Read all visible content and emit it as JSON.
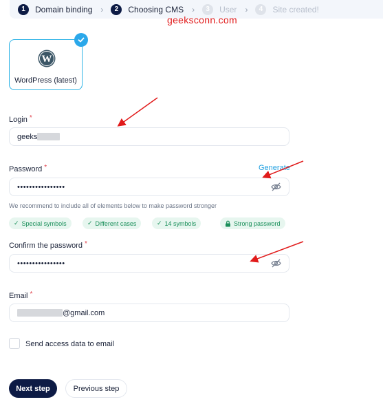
{
  "stepper": {
    "steps": [
      {
        "num": "1",
        "label": "Domain binding",
        "state": "done"
      },
      {
        "num": "2",
        "label": "Choosing CMS",
        "state": "current"
      },
      {
        "num": "3",
        "label": "User",
        "state": "inactive"
      },
      {
        "num": "4",
        "label": "Site created!",
        "state": "inactive"
      }
    ]
  },
  "watermark": "geeksconn.com",
  "cms": {
    "name": "WordPress (latest)",
    "selected": true
  },
  "form": {
    "login": {
      "label": "Login",
      "required_mark": "*",
      "value": "geeks"
    },
    "password": {
      "label": "Password",
      "required_mark": "*",
      "value": "••••••••••••••••",
      "generate_label": "Generate"
    },
    "hint": "We recommend to include all of elements below to make password stronger",
    "chips": [
      {
        "label": "Special symbols",
        "icon": "check-icon"
      },
      {
        "label": "Different cases",
        "icon": "check-icon"
      },
      {
        "label": "14 symbols",
        "icon": "check-icon"
      },
      {
        "label": "Strong password",
        "icon": "lock-icon"
      }
    ],
    "confirm": {
      "label": "Confirm the password",
      "required_mark": "*",
      "value": "••••••••••••••••"
    },
    "email": {
      "label": "Email",
      "required_mark": "*",
      "value": "@gmail.com"
    },
    "send_access": {
      "label": "Send access data to email",
      "checked": false
    }
  },
  "buttons": {
    "next": "Next step",
    "previous": "Previous step"
  },
  "colors": {
    "accent": "#2ba8ea",
    "primary_dark": "#0d1b45",
    "success": "#1a8f5a",
    "required": "#e0404a",
    "annotation": "#e11b1b"
  }
}
